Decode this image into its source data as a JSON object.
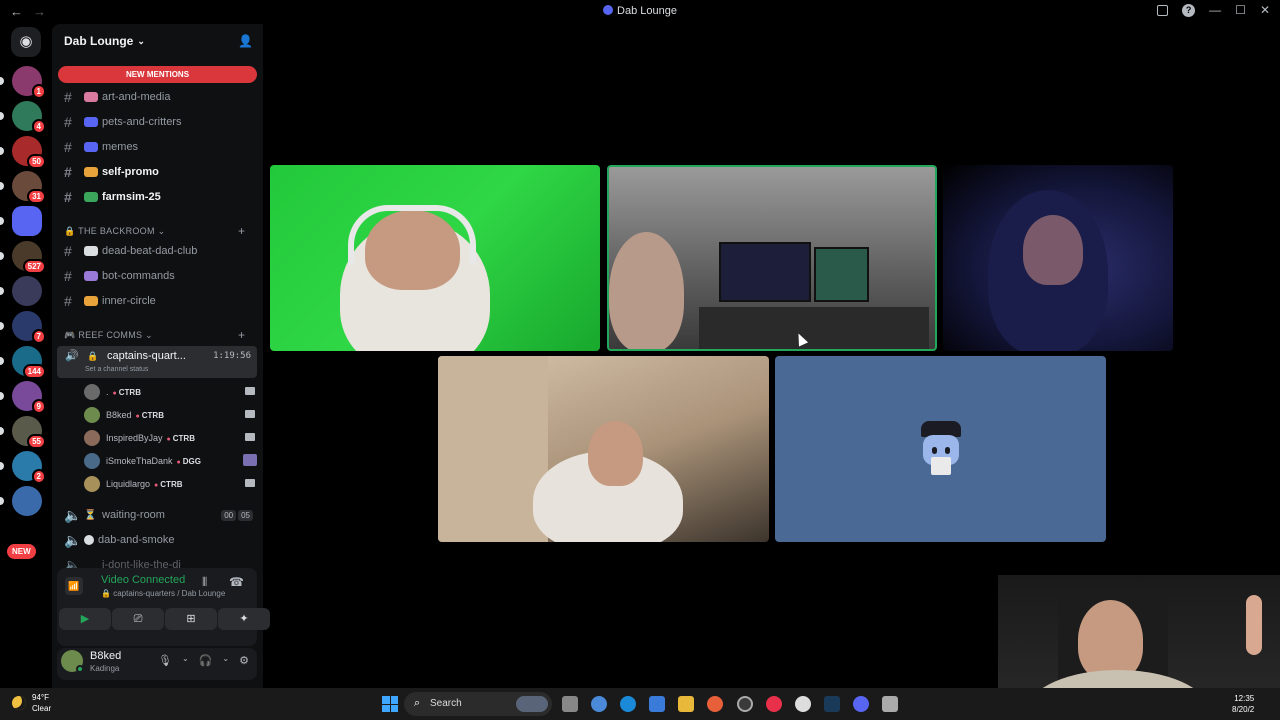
{
  "window": {
    "title": "Dab Lounge",
    "back_icon": "←",
    "forward_icon": "→"
  },
  "server_rail": {
    "home_icon": "discord-logo",
    "new_label": "NEW",
    "servers": [
      {
        "badge": "1",
        "color": "#8b3a6e"
      },
      {
        "badge": "4",
        "color": "#2f7a5a"
      },
      {
        "badge": "50",
        "color": "#a82a2a"
      },
      {
        "badge": "31",
        "color": "#6a4a3a"
      },
      {
        "badge": "",
        "color": "#5865f2"
      },
      {
        "badge": "527",
        "color": "#4a3a2a"
      },
      {
        "badge": "",
        "color": "#3a3a5a"
      },
      {
        "badge": "7",
        "color": "#2a3a6a"
      },
      {
        "badge": "144",
        "color": "#1a6a8a"
      },
      {
        "badge": "9",
        "color": "#7a4a9a"
      },
      {
        "badge": "55",
        "color": "#5a5a4a"
      },
      {
        "badge": "2",
        "color": "#2a7aaa"
      },
      {
        "badge": "",
        "color": "#3a6aaa"
      }
    ]
  },
  "sidebar": {
    "server_name": "Dab Lounge",
    "new_mentions": "NEW MENTIONS",
    "channels_top": [
      {
        "name": "art-and-media",
        "unread": false,
        "emo": "#d97aa0"
      },
      {
        "name": "pets-and-critters",
        "unread": false,
        "emo": "#5865f2"
      },
      {
        "name": "memes",
        "unread": false,
        "emo": "#5865f2"
      },
      {
        "name": "self-promo",
        "unread": true,
        "emo": "#e8a33a"
      },
      {
        "name": "farmsim-25",
        "unread": true,
        "emo": "#3ba55c"
      }
    ],
    "category_backroom": "THE BACKROOM",
    "channels_backroom": [
      {
        "name": "dead-beat-dad-club",
        "emo": "#dbdee1"
      },
      {
        "name": "bot-commands",
        "emo": "#9a7ad8"
      },
      {
        "name": "inner-circle",
        "emo": "#e8a33a"
      }
    ],
    "category_reef": "REEF COMMS",
    "active_voice": {
      "name": "captains-quart...",
      "time": "1:19:56",
      "status": "Set a channel status"
    },
    "members": [
      {
        "name": ".",
        "tag": "CTRB",
        "av": "#6a6a6a"
      },
      {
        "name": "B8ked",
        "tag": "CTRB",
        "av": "#6e8b4e"
      },
      {
        "name": "InspiredByJay",
        "tag": "CTRB",
        "av": "#8a6a5a"
      },
      {
        "name": "iSmokeThaDank",
        "tag": "DGG",
        "av": "#4a6a8a"
      },
      {
        "name": "Liquidlargo",
        "tag": "CTRB",
        "av": "#a8905a"
      }
    ],
    "waiting_room": {
      "name": "waiting-room",
      "count_a": "00",
      "count_b": "05"
    },
    "dab_and_smoke": "dab-and-smoke",
    "partial_channel": "i-dont-like-the-di"
  },
  "voice_panel": {
    "title": "Video Connected",
    "subtitle": "captains-quarters / Dab Lounge"
  },
  "user_panel": {
    "name": "B8ked",
    "status": "Kadinga"
  },
  "taskbar": {
    "temp": "94°F",
    "condition": "Clear",
    "search_label": "Search",
    "time": "12:35",
    "date": "8/20/2"
  }
}
